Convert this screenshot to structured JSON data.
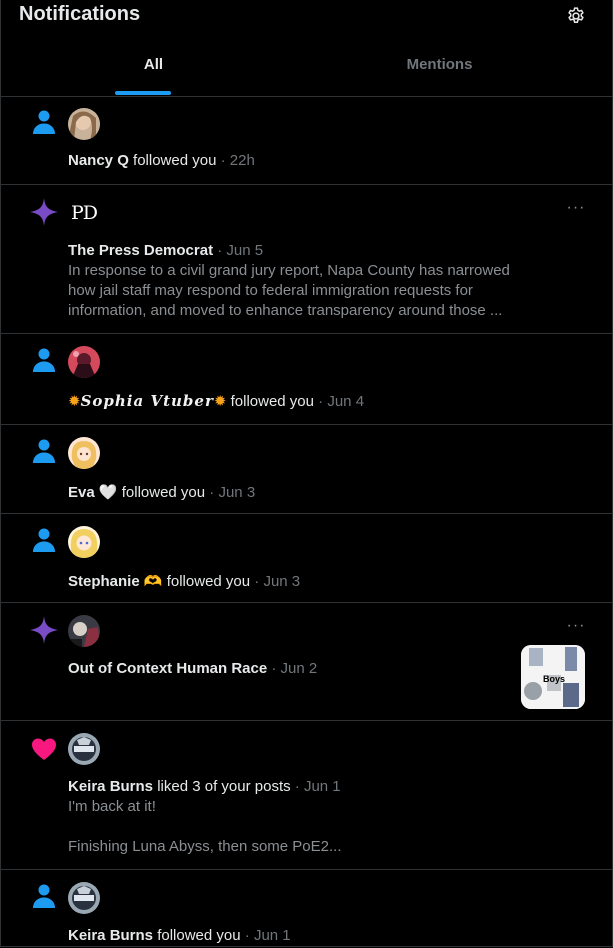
{
  "header": {
    "title": "Notifications",
    "settings_icon": "gear-icon"
  },
  "tabs": [
    {
      "label": "All",
      "active": true
    },
    {
      "label": "Mentions",
      "active": false
    }
  ],
  "colors": {
    "accent": "#1d9bf0",
    "follow_icon": "#1d9bf0",
    "post_icon": "#794bc4",
    "like_icon": "#f91880"
  },
  "notifications": [
    {
      "type": "follow",
      "icon": "person-icon",
      "name": "Nancy Q",
      "action": "followed you",
      "sep": "·",
      "time": "22h"
    },
    {
      "type": "post",
      "icon": "sparkle-icon",
      "avatar_text": "PD",
      "name": "The Press Democrat",
      "sep": "·",
      "time": "Jun 5",
      "text_lines": [
        "In response to a civil grand jury report, Napa County has narrowed",
        "how jail staff may respond to federal immigration requests for",
        "information, and moved to enhance transparency around those ..."
      ],
      "more": "···"
    },
    {
      "type": "follow",
      "icon": "person-icon",
      "name": "Sophia Vtuber",
      "name_decoration": "✹",
      "action": "followed you",
      "sep": "·",
      "time": "Jun 4"
    },
    {
      "type": "follow",
      "icon": "person-icon",
      "name": "Eva",
      "name_emoji": "🤍",
      "action": "followed you",
      "sep": "·",
      "time": "Jun 3"
    },
    {
      "type": "follow",
      "icon": "person-icon",
      "name": "Stephanie",
      "name_emoji": "🫶",
      "action": "followed you",
      "sep": "·",
      "time": "Jun 3"
    },
    {
      "type": "post",
      "icon": "sparkle-icon",
      "name": "Out of Context Human Race",
      "sep": "·",
      "time": "Jun 2",
      "more": "···",
      "thumbnail_text": "Boys"
    },
    {
      "type": "like",
      "icon": "heart-icon",
      "name": "Keira Burns",
      "action": "liked 3 of your posts",
      "sep": "·",
      "time": "Jun 1",
      "text_lines": [
        "I'm back at it!",
        "",
        "Finishing Luna Abyss, then some PoE2..."
      ]
    },
    {
      "type": "follow",
      "icon": "person-icon",
      "name": "Keira Burns",
      "action": "followed you",
      "sep": "·",
      "time": "Jun 1"
    }
  ]
}
